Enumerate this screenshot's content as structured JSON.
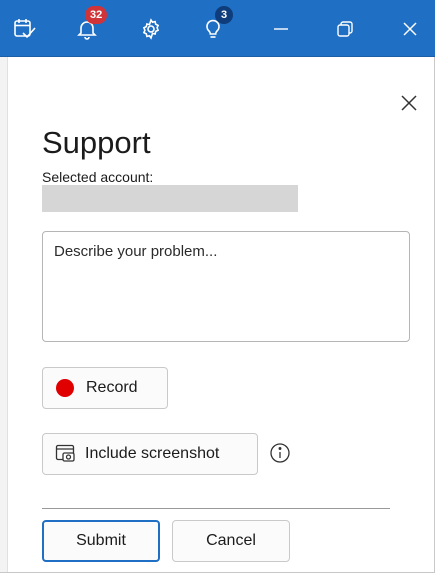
{
  "titlebar": {
    "notifications_badge": "32",
    "tips_badge": "3",
    "accent": "#1f6fc4"
  },
  "panel": {
    "title": "Support",
    "account_label": "Selected account:",
    "description_placeholder": "Describe your problem...",
    "record_label": "Record",
    "screenshot_label": "Include screenshot",
    "submit_label": "Submit",
    "cancel_label": "Cancel"
  },
  "icons": {
    "titlebar": [
      "task-check-icon",
      "bell-icon",
      "gear-icon",
      "lightbulb-icon",
      "minimize-icon",
      "restore-icon",
      "close-icon"
    ],
    "panel": [
      "close-icon",
      "record-dot-icon",
      "screenshot-icon",
      "info-icon"
    ]
  },
  "colors": {
    "record_dot": "#e00000",
    "badge_red": "#d13438",
    "badge_dark": "#0f3c7a"
  }
}
